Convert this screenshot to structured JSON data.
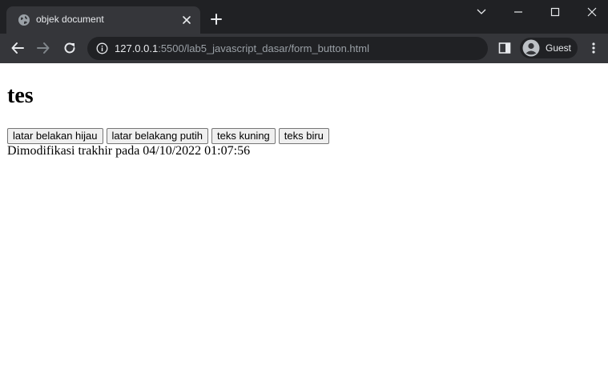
{
  "browser": {
    "tab": {
      "title": "objek document",
      "favicon": "globe-icon"
    },
    "address": {
      "host": "127.0.0.1",
      "rest": ":5500/lab5_javascript_dasar/form_button.html"
    },
    "profile": {
      "name": "Guest"
    },
    "icons": {
      "close": "close-icon",
      "new_tab": "plus-icon",
      "back": "back-arrow-icon",
      "forward": "forward-arrow-icon",
      "reload": "reload-icon",
      "info": "info-icon",
      "side_panel": "side-panel-icon",
      "avatar": "avatar-icon",
      "menu": "kebab-menu-icon"
    },
    "colors": {
      "frame": "#202124",
      "toolbar": "#35363a",
      "text": "#e8eaed",
      "muted": "#9aa0a6"
    }
  },
  "page": {
    "heading": "tes",
    "buttons": [
      {
        "label": "latar belakan hijau"
      },
      {
        "label": "latar belakang putih"
      },
      {
        "label": "teks kuning"
      },
      {
        "label": "teks biru"
      }
    ],
    "last_modified": "Dimodifikasi trakhir pada 04/10/2022 01:07:56"
  }
}
